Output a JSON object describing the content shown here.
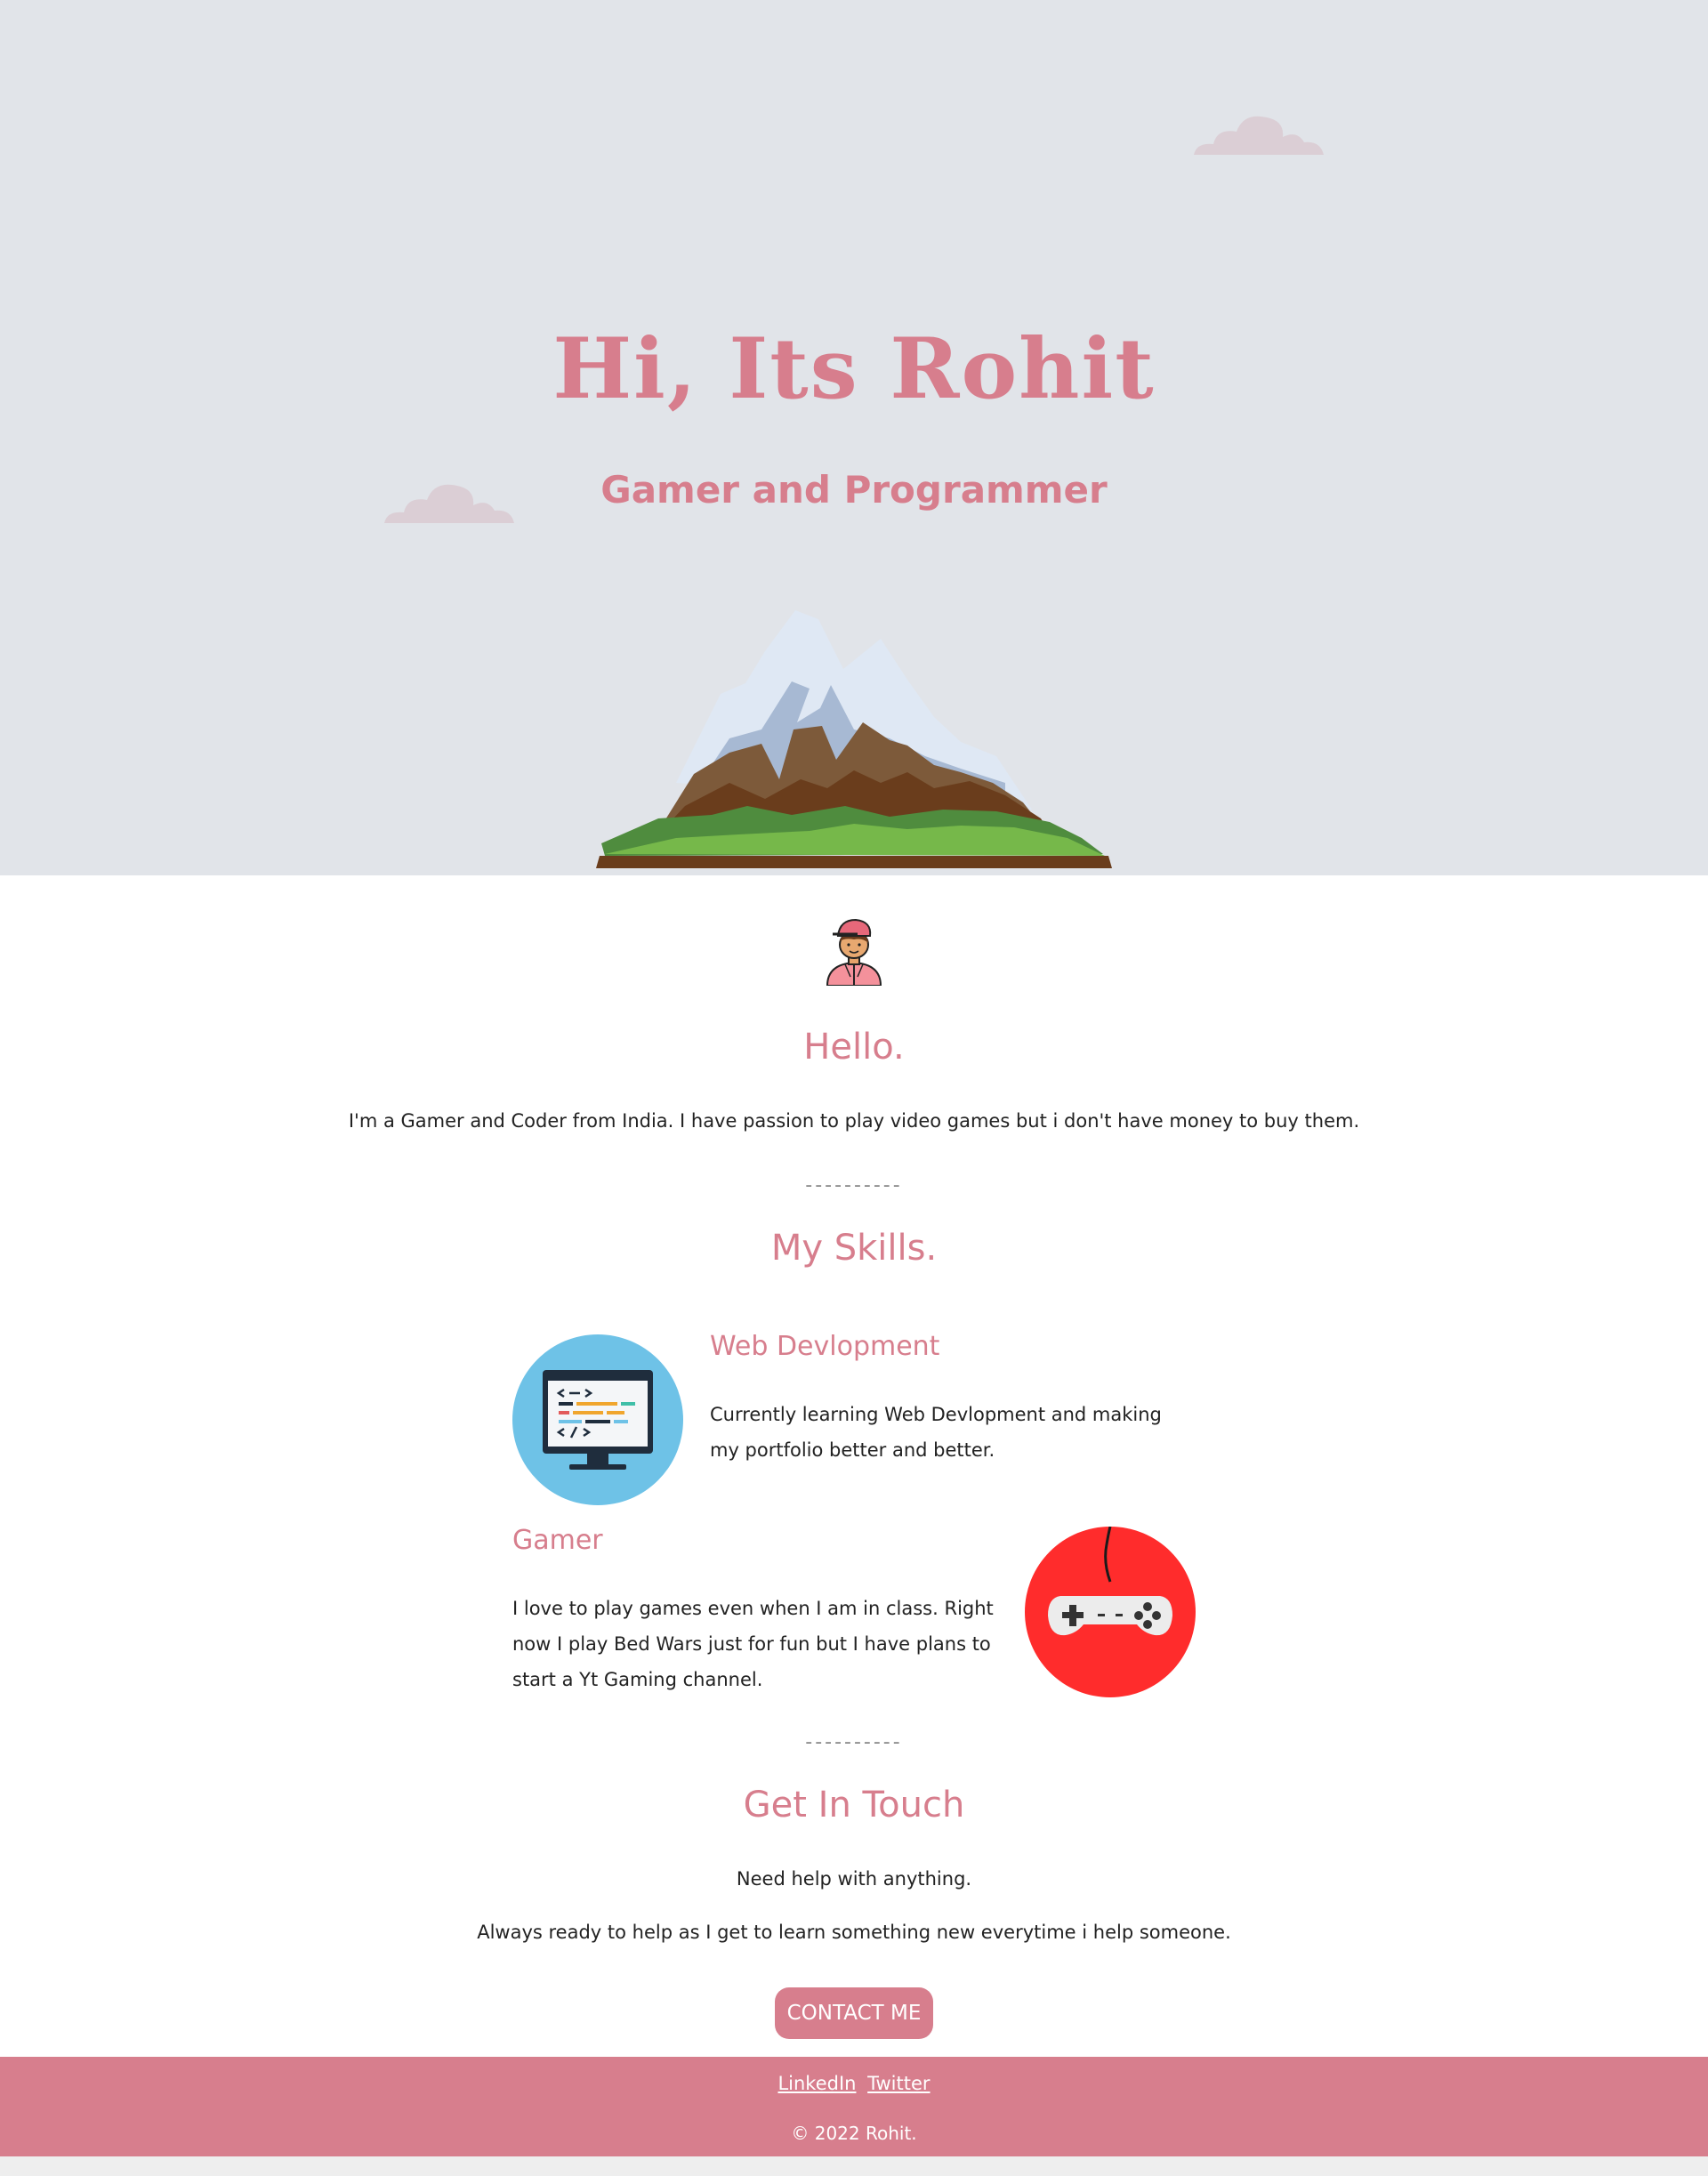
{
  "hero": {
    "title": "Hi, Its Rohit",
    "subtitle": "Gamer and Programmer"
  },
  "about": {
    "heading": "Hello.",
    "text": "I'm a Gamer and Coder from India. I have passion to play video games but i don't have money to buy them."
  },
  "divider": "----------",
  "skills": {
    "heading": "My Skills.",
    "items": [
      {
        "title": "Web Devlopment",
        "description": "Currently learning Web Devlopment and making my portfolio better and better.",
        "icon": "computer-code-icon"
      },
      {
        "title": "Gamer",
        "description": "I love to play games even when I am in class. Right now I play Bed Wars just for fun but I have plans to start a Yt Gaming channel.",
        "icon": "game-controller-icon"
      }
    ]
  },
  "contact": {
    "heading": "Get In Touch",
    "line1": "Need help with anything.",
    "line2": "Always ready to help as I get to learn something new everytime i help someone.",
    "button_label": "CONTACT ME"
  },
  "footer": {
    "links": [
      "LinkedIn",
      "Twitter"
    ],
    "copyright": "© 2022 Rohit."
  },
  "colors": {
    "accent": "#d77e8d",
    "hero_background": "#e1e4e9",
    "controller_background": "#ff2c2c",
    "computer_background": "#6ec2e7"
  }
}
